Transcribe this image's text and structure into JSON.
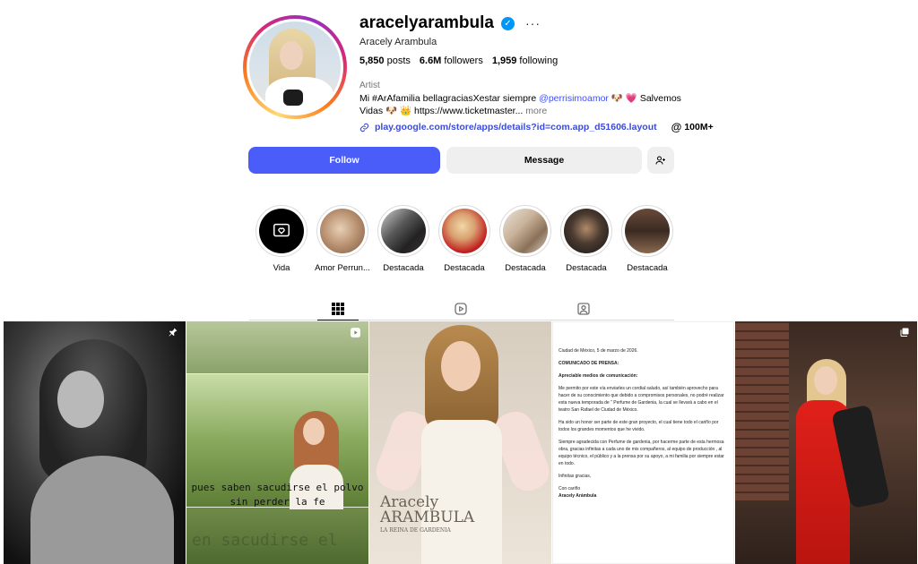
{
  "profile": {
    "username": "aracelyarambula",
    "full_name": "Aracely Arambula",
    "more_label": "···",
    "verified_mark": "✓",
    "stats": {
      "posts_value": "5,850",
      "posts_label": "posts",
      "followers_value": "6.6M",
      "followers_label": "followers",
      "following_value": "1,959",
      "following_label": "following"
    },
    "category": "Artist",
    "bio_line1_text": "Mi #ArAfamilia bellagraciasXestar siempre ",
    "bio_mention": "@perrisimoamor",
    "bio_line1_tail": " 🐶 💗 Salvemos",
    "bio_line2_text": "Vidas 🐶 👑 https://www.ticketmaster...",
    "bio_more": " more",
    "link": "play.google.com/store/apps/details?id=com.app_d51606.layout",
    "threads_count": "100M+"
  },
  "actions": {
    "follow_label": "Follow",
    "message_label": "Message",
    "add_user_icon": "add-user-icon"
  },
  "highlights": [
    {
      "label": "Vida"
    },
    {
      "label": "Amor Perrun..."
    },
    {
      "label": "Destacada"
    },
    {
      "label": "Destacada"
    },
    {
      "label": "Destacada"
    },
    {
      "label": "Destacada"
    },
    {
      "label": "Destacada"
    }
  ],
  "tabs": [
    {
      "icon": "grid-icon",
      "active": true
    },
    {
      "icon": "reels-icon",
      "active": false
    },
    {
      "icon": "tagged-icon",
      "active": false
    }
  ],
  "posts": {
    "p2_caption_line1": "pues saben sacudirse el polvo",
    "p2_caption_line2": "sin perder la fe",
    "p2_ghost": "en sacudirse el",
    "p3_title_line1": "Aracely",
    "p3_title_line2": "ARAMBULA",
    "p3_subtitle": "LA REINA DE GARDENIA",
    "p4_date": "Ciudad de México, 5 de marzo de 2026.",
    "p4_heading": "COMUNICADO DE PRENSA:",
    "p4_salutation": "Apreciable medios de comunicación:",
    "p4_para1": "Me permito por este vía enviarles un cordial saludo, así también aprovecho para hacer de su conocimiento que debido a compromisos personales, no podré realizar esta nueva temporada de \" Perfume de Gardenia, la cual se llevará a cabo en el teatro San Rafael de Ciudad de México.",
    "p4_para2": "Ha sido un honor ser parte de este gran proyecto, el cual tiene todo el cariño por todos los grandes momentos que he vivido.",
    "p4_para3": "Siempre agradecida con Perfume de gardenia, por hacerme parte de esta hermosa obra, gracias infinitas a cada uno de mis compañeros, al equipo de producción , al equipo técnico, el público y a la prensa por su apoyo, a mi familia por siempre estar en todo.",
    "p4_thanks": "Infinitas gracias,",
    "p4_closing": "Con cariño",
    "p4_signature": "Aracely Arámbula"
  },
  "colors": {
    "follow_button": "#4a5df9",
    "link": "#3b4bd8",
    "verified": "#0095f6"
  }
}
